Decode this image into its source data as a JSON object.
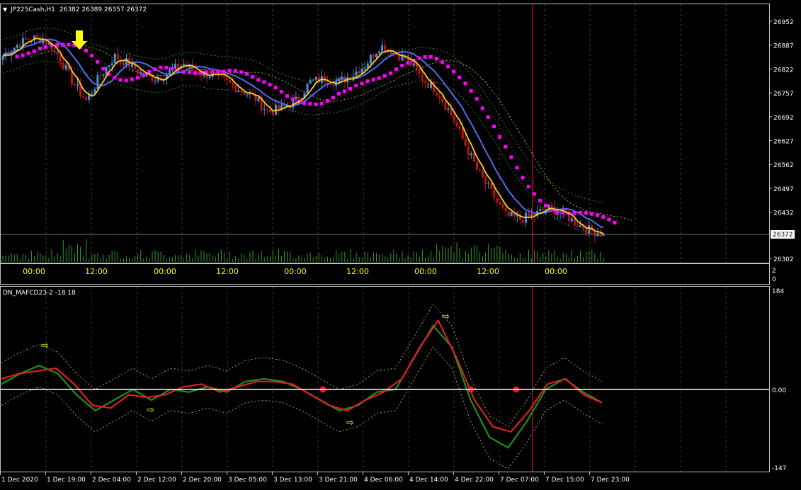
{
  "main_chart": {
    "header": {
      "arrow_glyph": "▼",
      "symbol": "JP225Cash,H1",
      "ohlc": "26382 26389 26357 26372"
    },
    "price_axis": [
      "26952",
      "26887",
      "26822",
      "26757",
      "26692",
      "26627",
      "26562",
      "26497",
      "26432",
      "26372",
      "26302"
    ],
    "current_price": "26372",
    "time_labels": [
      "00:00",
      "12:00",
      "00:00",
      "12:00",
      "00:00",
      "12:00",
      "00:00",
      "12:00",
      "00:00"
    ],
    "small_axis": [
      "2",
      "0"
    ]
  },
  "indicator": {
    "title": "DN_MAFCD23-2 -18 18",
    "axis": [
      "184",
      "0.00",
      "-147"
    ]
  },
  "date_axis": [
    "1 Dec 2020",
    "1 Dec 19:00",
    "2 Dec 04:00",
    "2 Dec 12:00",
    "2 Dec 20:00",
    "3 Dec 05:00",
    "3 Dec 13:00",
    "3 Dec 21:00",
    "4 Dec 06:00",
    "4 Dec 14:00",
    "4 Dec 22:00",
    "7 Dec 07:00",
    "7 Dec 15:00",
    "7 Dec 23:00"
  ],
  "colors": {
    "background": "#000000",
    "frame": "#c0c0c0",
    "text": "#ffffff",
    "bull_candle": "#4a8fd9",
    "bear_candle": "#b81515",
    "volume": "#2e9e2e",
    "yellow_ma": "#ffd21e",
    "magenta_ma": "#ff00ff",
    "blue_ma": "#4c6ef0",
    "red_line": "#e02020",
    "green_line": "#1e8e1e",
    "zero_line": "#ffffff",
    "signal_arrow": "#ffff00"
  },
  "chart_data": [
    {
      "type": "candlestick",
      "title": "JP225Cash,H1",
      "overlays": [
        "yellow moving average",
        "magenta moving average",
        "blue moving average",
        "dotted bands",
        "volume bars"
      ],
      "close_path": [
        26850,
        26880,
        26900,
        26895,
        26850,
        26780,
        26730,
        26800,
        26850,
        26830,
        26800,
        26790,
        26810,
        26830,
        26805,
        26800,
        26780,
        26760,
        26740,
        26700,
        26710,
        26730,
        26780,
        26790,
        26780,
        26800,
        26830,
        26880,
        26860,
        26840,
        26790,
        26760,
        26700,
        26620,
        26540,
        26480,
        26420,
        26410,
        26420,
        26440,
        26430,
        26400,
        26380,
        26372
      ],
      "ylim": [
        26302,
        26987
      ],
      "grid": true,
      "last_price": 26372
    },
    {
      "type": "line",
      "title": "DN_MAFCD23-2 -18 18",
      "series": [
        {
          "values": [
            10,
            30,
            45,
            30,
            -10,
            -40,
            -20,
            0,
            -20,
            0,
            -5,
            5,
            -5,
            15,
            20,
            15,
            0,
            -20,
            -40,
            -30,
            -5,
            0,
            60,
            120,
            80,
            -20,
            -90,
            -110,
            -60,
            0,
            20,
            -5,
            -25
          ]
        },
        {
          "values": [
            20,
            30,
            35,
            40,
            10,
            -30,
            -35,
            -10,
            -15,
            -10,
            5,
            10,
            -5,
            5,
            15,
            15,
            10,
            -10,
            -30,
            -40,
            -20,
            -5,
            20,
            80,
            130,
            60,
            -20,
            -70,
            -80,
            -40,
            10,
            20,
            -10,
            -25
          ]
        }
      ],
      "ylim": [
        -147,
        184
      ],
      "zero_line": true
    }
  ]
}
